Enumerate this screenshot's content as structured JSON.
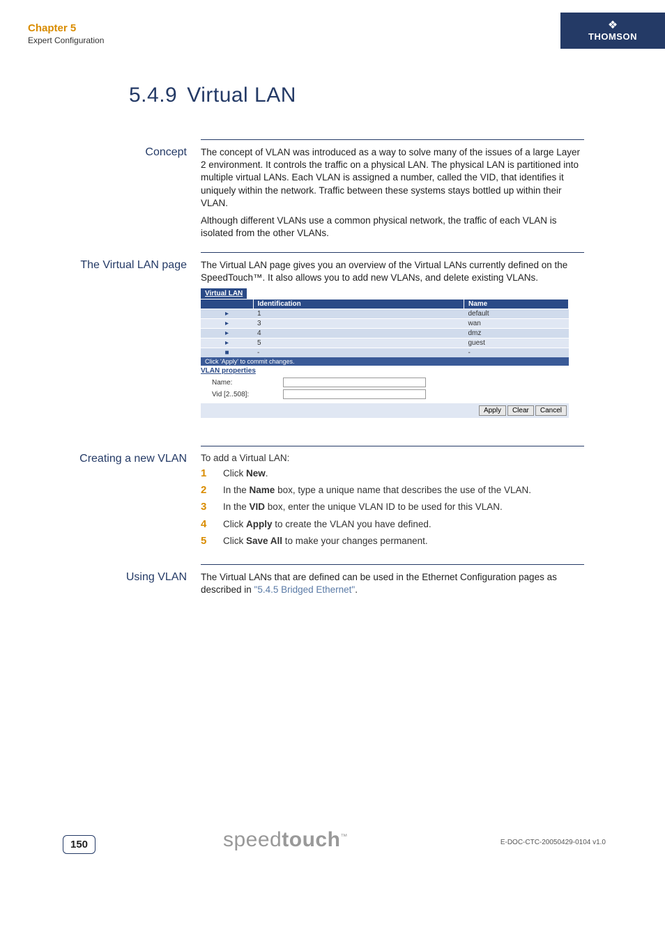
{
  "header": {
    "chapter_title": "Chapter 5",
    "chapter_sub": "Expert Configuration",
    "brand": "THOMSON"
  },
  "title": {
    "number": "5.4.9",
    "text": "Virtual LAN"
  },
  "concept": {
    "label": "Concept",
    "p1": "The concept of VLAN was introduced as a way to solve many of the issues of a large Layer 2 environment. It controls the traffic on a physical LAN. The physical LAN is partitioned into multiple virtual LANs. Each VLAN is assigned a number, called the VID, that identifies it uniquely within the network. Traffic between these systems stays bottled up within their VLAN.",
    "p2": "Although different VLANs use a common physical network, the traffic of each VLAN is isolated from the other VLANs."
  },
  "vlan_page": {
    "label": "The Virtual LAN page",
    "p1": "The Virtual LAN page gives you an overview of the Virtual LANs currently defined on the SpeedTouch™. It also allows you to add new VLANs, and delete existing VLANs."
  },
  "screenshot": {
    "tab": "Virtual LAN",
    "col_id": "Identification",
    "col_name": "Name",
    "rows": [
      {
        "icon": "▸",
        "id": "1",
        "name": "default"
      },
      {
        "icon": "▸",
        "id": "3",
        "name": "wan"
      },
      {
        "icon": "▸",
        "id": "4",
        "name": "dmz"
      },
      {
        "icon": "▸",
        "id": "5",
        "name": "guest"
      },
      {
        "icon": "■",
        "id": "-",
        "name": "-"
      }
    ],
    "hint": "Click 'Apply' to commit changes.",
    "props_head": "VLAN properties",
    "name_label": "Name:",
    "vid_label": "Vid [2..508]:",
    "btn_apply": "Apply",
    "btn_clear": "Clear",
    "btn_cancel": "Cancel"
  },
  "creating": {
    "label": "Creating a new VLAN",
    "intro": "To add a Virtual LAN:",
    "steps": [
      {
        "pre": "Click ",
        "bold": "New",
        "post": "."
      },
      {
        "pre": "In the ",
        "bold": "Name",
        "post": " box, type a unique name that describes the use of the VLAN."
      },
      {
        "pre": "In the ",
        "bold": "VID",
        "post": " box, enter the unique VLAN ID to be used for this VLAN."
      },
      {
        "pre": "Click ",
        "bold": "Apply",
        "post": " to create the VLAN you have defined."
      },
      {
        "pre": "Click ",
        "bold": "Save All",
        "post": " to make your changes permanent."
      }
    ]
  },
  "using": {
    "label": "Using VLAN",
    "p1a": "The Virtual LANs that are defined can be used in the Ethernet Configuration pages as described in ",
    "link": "\"5.4.5 Bridged Ethernet\"",
    "p1b": "."
  },
  "footer": {
    "page": "150",
    "logo_light": "speed",
    "logo_bold": "touch",
    "tm": "™",
    "doc_id": "E-DOC-CTC-20050429-0104 v1.0"
  }
}
